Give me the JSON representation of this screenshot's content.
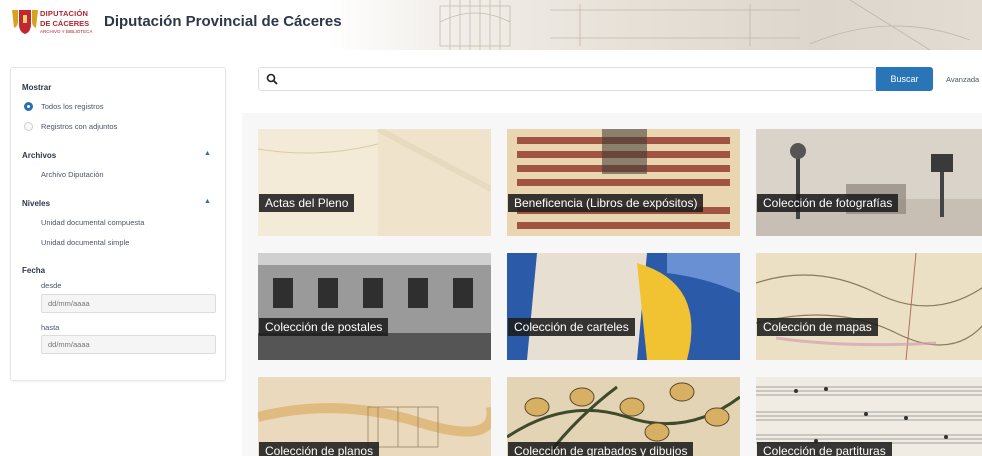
{
  "header": {
    "logo_line1": "DIPUTACIÓN",
    "logo_line2": "DE CÁCERES",
    "logo_line3": "ARCHIVO Y BIBLIOTECA",
    "title": "Diputación Provincial de Cáceres"
  },
  "sidebar": {
    "mostrar": {
      "heading": "Mostrar",
      "options": [
        "Todos los registros",
        "Registros con adjuntos"
      ],
      "selected": "Todos los registros"
    },
    "archivos": {
      "heading": "Archivos",
      "items": [
        "Archivo Diputación"
      ]
    },
    "niveles": {
      "heading": "Niveles",
      "items": [
        "Unidad documental compuesta",
        "Unidad documental simple"
      ]
    },
    "fecha": {
      "heading": "Fecha",
      "desde_label": "desde",
      "desde_placeholder": "dd/mm/aaaa",
      "hasta_label": "hasta",
      "hasta_placeholder": "dd/mm/aaaa"
    }
  },
  "search": {
    "button": "Buscar",
    "advanced": "Avanzada",
    "value": ""
  },
  "collections": [
    "Actas del Pleno",
    "Beneficencia (Libros de expósitos)",
    "Colección de fotografías",
    "Colección de postales",
    "Colección de carteles",
    "Colección de mapas",
    "Colección de planos",
    "Colección de grabados y dibujos",
    "Colección de partituras"
  ],
  "colors": {
    "accent": "#2a74b8",
    "brand": "#b3242d"
  }
}
